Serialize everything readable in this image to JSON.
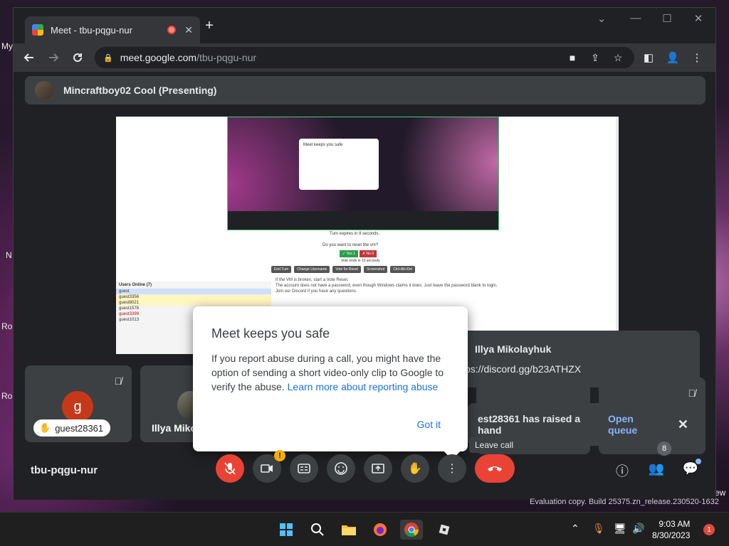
{
  "desktop": {
    "labels": [
      "My",
      "N",
      "Ro",
      "Ro",
      "ew"
    ]
  },
  "tab": {
    "title": "Meet - tbu-pqgu-nur",
    "close": "✕"
  },
  "new_tab": "+",
  "window": {
    "minimize": "⌄",
    "restore": "—",
    "maximize": "☐",
    "close": "✕"
  },
  "address": {
    "host": "meet.google.com",
    "path": "/tbu-pqgu-nur"
  },
  "presenter": {
    "label": "Mincraftboy02 Cool (Presenting)"
  },
  "shared_screen": {
    "popup_title": "Meet keeps you safe",
    "turn_text": "Turn expires in 8 seconds.",
    "vote_question": "Do you want to reset the vm?",
    "vote_yes": "✓ Yes 1",
    "vote_no": "✗ No 0",
    "vote_ends": "Vote ends in 10 seconds",
    "buttons": [
      "End Turn",
      "Change Username",
      "Vote for Reset",
      "Screenshot",
      "Ctrl+Alt+Del"
    ],
    "users_header": "Users Online (7)",
    "users": [
      "guest",
      "guest3356",
      "guest8021",
      "guest1578",
      "guest3399",
      "guest1013"
    ],
    "bullets": [
      "If the VM is broken, start a Vote Reset.",
      "The account does not have a password, even though Windows claims it does. Just leave the password blank to login.",
      "Join our Discord if you have any questions."
    ]
  },
  "tiles": [
    {
      "initial": "g",
      "name": "guest28361"
    },
    {
      "name": "Illya Mikol"
    }
  ],
  "popup": {
    "title": "Meet keeps you safe",
    "body": "If you report abuse during a call, you might have the option of sending a short video-only clip to Google to verify the abuse.",
    "link": "Learn more about reporting abuse",
    "action": "Got it"
  },
  "name_card": {
    "name": "Illya Mikolayhuk",
    "link": "ps://discord.gg/b23ATHZX"
  },
  "hand_notice": {
    "text": "est28361 has raised a hand",
    "action": "Open queue"
  },
  "meeting_code": "tbu-pqgu-nur",
  "tooltip": "Leave call",
  "participants_count": "8",
  "eval_text": "Evaluation copy. Build 25375.zn_release.230520-1632",
  "clock": {
    "time": "9:03 AM",
    "date": "8/30/2023"
  },
  "notifications": "1",
  "colors": {
    "leave": "#ea4335",
    "link": "#1a73e8",
    "queue": "#8ab4f8"
  }
}
